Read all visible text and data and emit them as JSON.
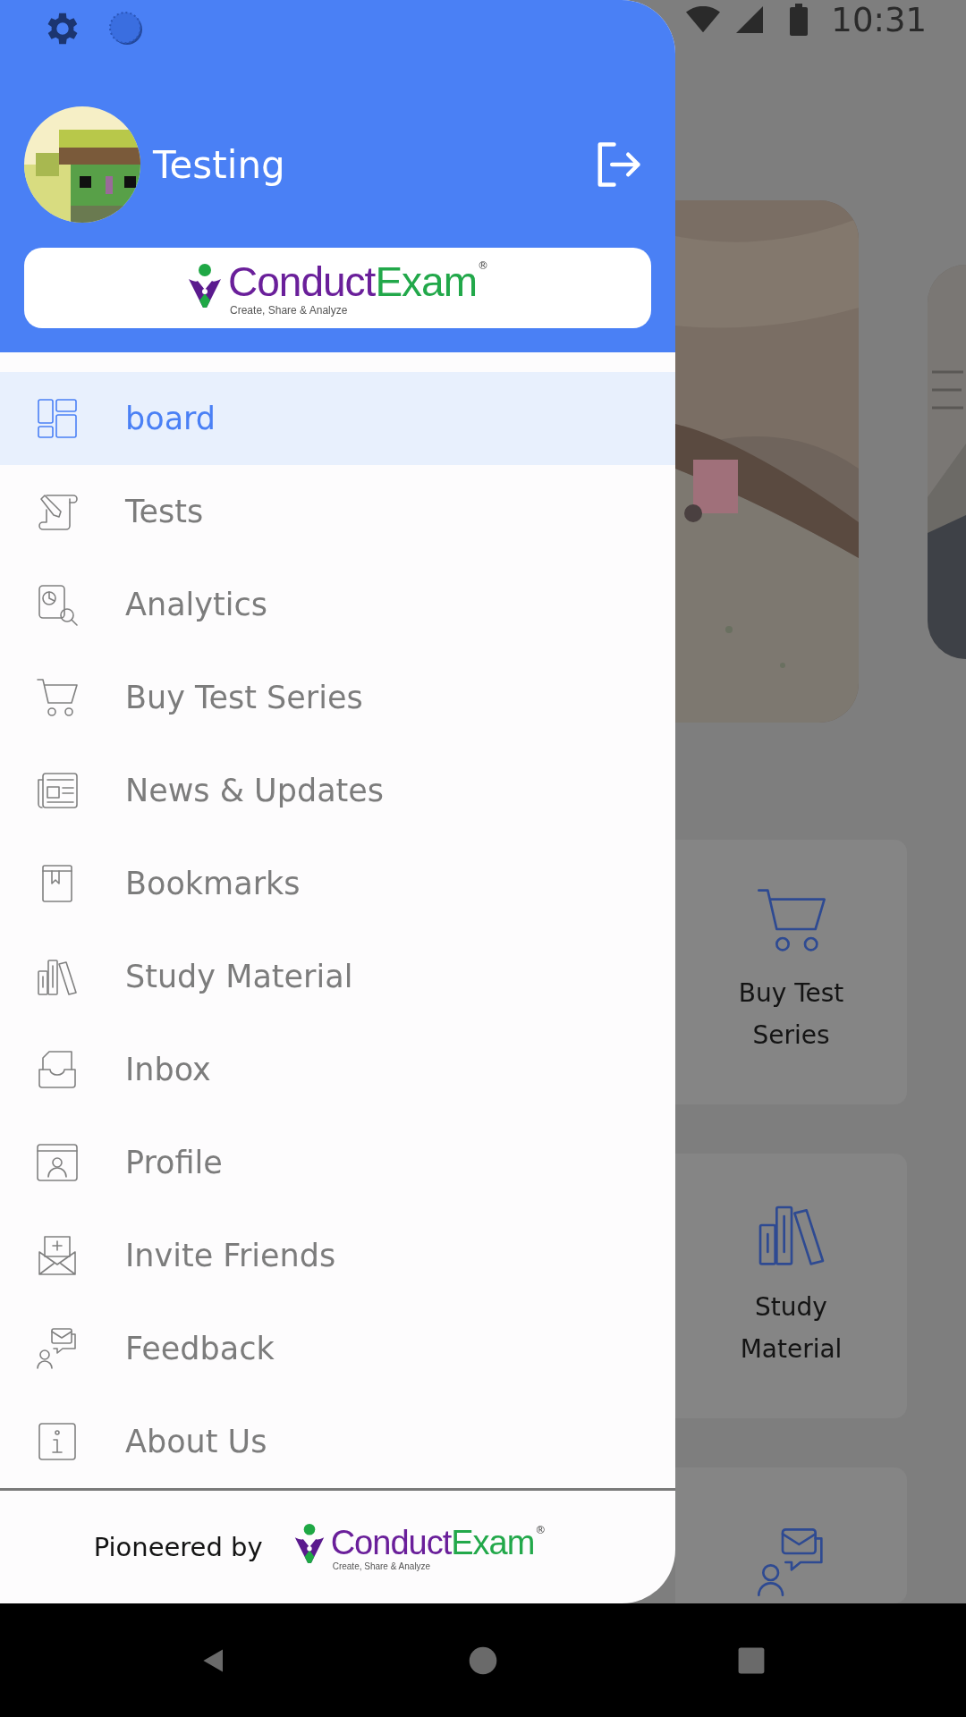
{
  "status_bar": {
    "time": "10:31"
  },
  "drawer": {
    "user": {
      "name": "Testing"
    },
    "logo": {
      "brand_first": "Conduct",
      "brand_second": "Exam",
      "registered": "®",
      "tagline": "Create, Share & Analyze"
    },
    "menu": [
      {
        "label": "board",
        "kind": "dashboard",
        "selected": true
      },
      {
        "label": "Tests",
        "kind": "tests",
        "selected": false
      },
      {
        "label": "Analytics",
        "kind": "analytics",
        "selected": false
      },
      {
        "label": "Buy Test Series",
        "kind": "cart",
        "selected": false
      },
      {
        "label": "News & Updates",
        "kind": "news",
        "selected": false
      },
      {
        "label": "Bookmarks",
        "kind": "bookmark",
        "selected": false
      },
      {
        "label": "Study Material",
        "kind": "books",
        "selected": false
      },
      {
        "label": "Inbox",
        "kind": "inbox",
        "selected": false
      },
      {
        "label": "Profile",
        "kind": "profile",
        "selected": false
      },
      {
        "label": "Invite Friends",
        "kind": "invite",
        "selected": false
      },
      {
        "label": "Feedback",
        "kind": "feedback",
        "selected": false
      },
      {
        "label": "About Us",
        "kind": "info",
        "selected": false
      }
    ],
    "footer": {
      "label": "Pioneered by",
      "logo": {
        "brand_first": "Conduct",
        "brand_second": "Exam",
        "registered": "®",
        "tagline": "Create, Share & Analyze"
      }
    }
  },
  "background": {
    "cards": [
      {
        "label": "Buy Test Series",
        "kind": "cart"
      },
      {
        "label": "Study Material",
        "kind": "books"
      },
      {
        "kind": "feedback"
      }
    ]
  }
}
